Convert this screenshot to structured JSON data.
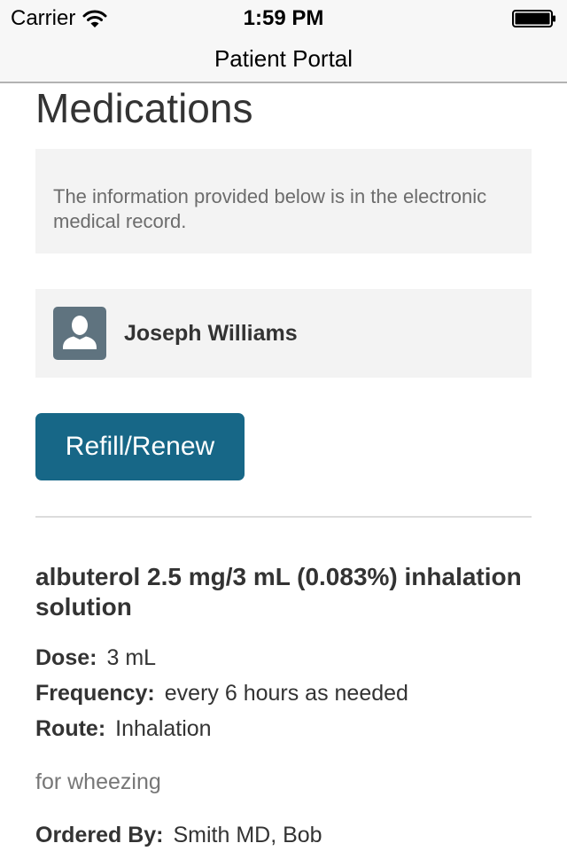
{
  "status_bar": {
    "carrier": "Carrier",
    "time": "1:59 PM",
    "icons": [
      "wifi-icon",
      "battery-icon"
    ]
  },
  "nav_bar": {
    "title": "Patient Portal"
  },
  "page": {
    "title": "Medications",
    "info_text": "The information provided below is in the electronic medical record."
  },
  "patient": {
    "name": "Joseph Williams",
    "avatar_icon": "person-icon",
    "avatar_color": "#5f737f"
  },
  "actions": {
    "refill_label": "Refill/Renew",
    "button_color": "#176787"
  },
  "medication": {
    "name": "albuterol 2.5 mg/3 mL (0.083%) inhalation solution",
    "dose_label": "Dose:",
    "dose_value": "3 mL",
    "frequency_label": "Frequency:",
    "frequency_value": "every 6 hours as needed",
    "route_label": "Route:",
    "route_value": "Inhalation",
    "note": "for wheezing",
    "ordered_by_label": "Ordered By:",
    "ordered_by_value": "Smith MD, Bob"
  }
}
